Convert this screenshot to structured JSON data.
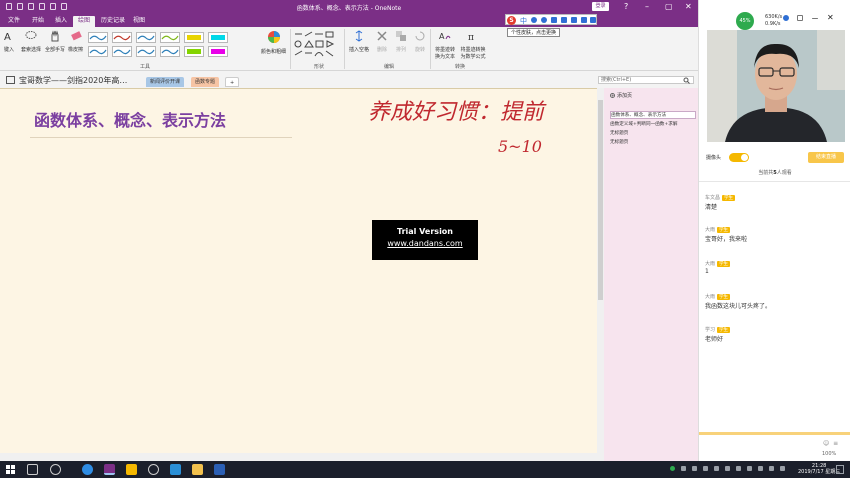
{
  "window": {
    "title": "函数体系、概念、表示方法 - OneNote",
    "login_label": "登录",
    "controls": [
      "?",
      "–",
      "▢",
      "✕"
    ]
  },
  "ribbon_tabs": [
    "文件",
    "开始",
    "插入",
    "绘图",
    "历史记录",
    "视图"
  ],
  "ribbon_active_tab": "绘图",
  "ribbon": {
    "tools": [
      "键入",
      "套索选择",
      "全部手写",
      "橡皮擦"
    ],
    "color_button": "颜色和粗细",
    "insert_space": "插入空格",
    "edit_tools": [
      "删除",
      "排列",
      "旋转"
    ],
    "convert_ink": "将墨迹转换为文本",
    "convert_math": "将墨迹转换为数学公式",
    "group_labels": [
      "工具",
      "形状",
      "编辑",
      "转换"
    ]
  },
  "pen_colors": [
    "#2d7fb8",
    "#c0392b",
    "#2d7fb8",
    "#7fb81a",
    "#e8d400",
    "#00d8e8",
    "#2d7fb8",
    "#2d7fb8",
    "#2d7fb8",
    "#2d7fb8",
    "#84d400",
    "#e800e8"
  ],
  "notebook": {
    "name": "宝哥数学——剑指2020年高…",
    "sections": [
      "新闻评价开课",
      "函数专题"
    ],
    "active_section": "函数专题",
    "add_label": "+"
  },
  "search": {
    "placeholder": "搜索(Ctrl+E)"
  },
  "page": {
    "title": "函数体系、概念、表示方法",
    "ink_line1": "养成好习惯：提前",
    "ink_line2": "5~10",
    "watermark_line1": "Trial Version",
    "watermark_line2": "www.dandans.com"
  },
  "pages_pane": {
    "add_label": "添加页",
    "items": [
      "函数体系、概念、表示方法",
      "函数定义域+判断同一函数+求解",
      "无标题页",
      "无标题页"
    ]
  },
  "float_toolbar": {
    "logo": "S",
    "label_zh": "中",
    "tooltip": "个性皮肤，点击更换"
  },
  "stream": {
    "net_percent": "45%",
    "net_up": "630K/s",
    "net_down": "0.9K/s",
    "camera_label": "摄像头",
    "teach_button": "结束直播",
    "viewers_prefix": "当前共",
    "viewers_count": "5",
    "viewers_suffix": "人观看",
    "messages": [
      {
        "name": "车文昌",
        "badge": "学生",
        "text": "清楚"
      },
      {
        "name": "大雨",
        "badge": "学生",
        "text": "宝哥好，我来啦"
      },
      {
        "name": "大雨",
        "badge": "学生",
        "text": "1"
      },
      {
        "name": "大雨",
        "badge": "学生",
        "text": "我函数这块儿可头疼了。"
      },
      {
        "name": "学习",
        "badge": "学生",
        "text": "老师好"
      }
    ]
  },
  "taskbar": {
    "time": "21:28",
    "date": "2019/7/17 星期三",
    "zoom": "100%"
  }
}
